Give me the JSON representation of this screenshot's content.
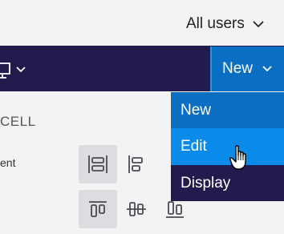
{
  "header": {
    "user_filter": "All users"
  },
  "navbar": {
    "device_icon": "monitor-icon",
    "new_button_label": "New"
  },
  "panel": {
    "section_title": "CELL",
    "alignment_label_partial": "ent"
  },
  "dropdown": {
    "items": [
      {
        "label": "New"
      },
      {
        "label": "Edit"
      },
      {
        "label": "Display"
      }
    ]
  },
  "colors": {
    "navbar": "#211b4e",
    "primary": "#0a6fc2",
    "hover": "#0a8bea"
  }
}
